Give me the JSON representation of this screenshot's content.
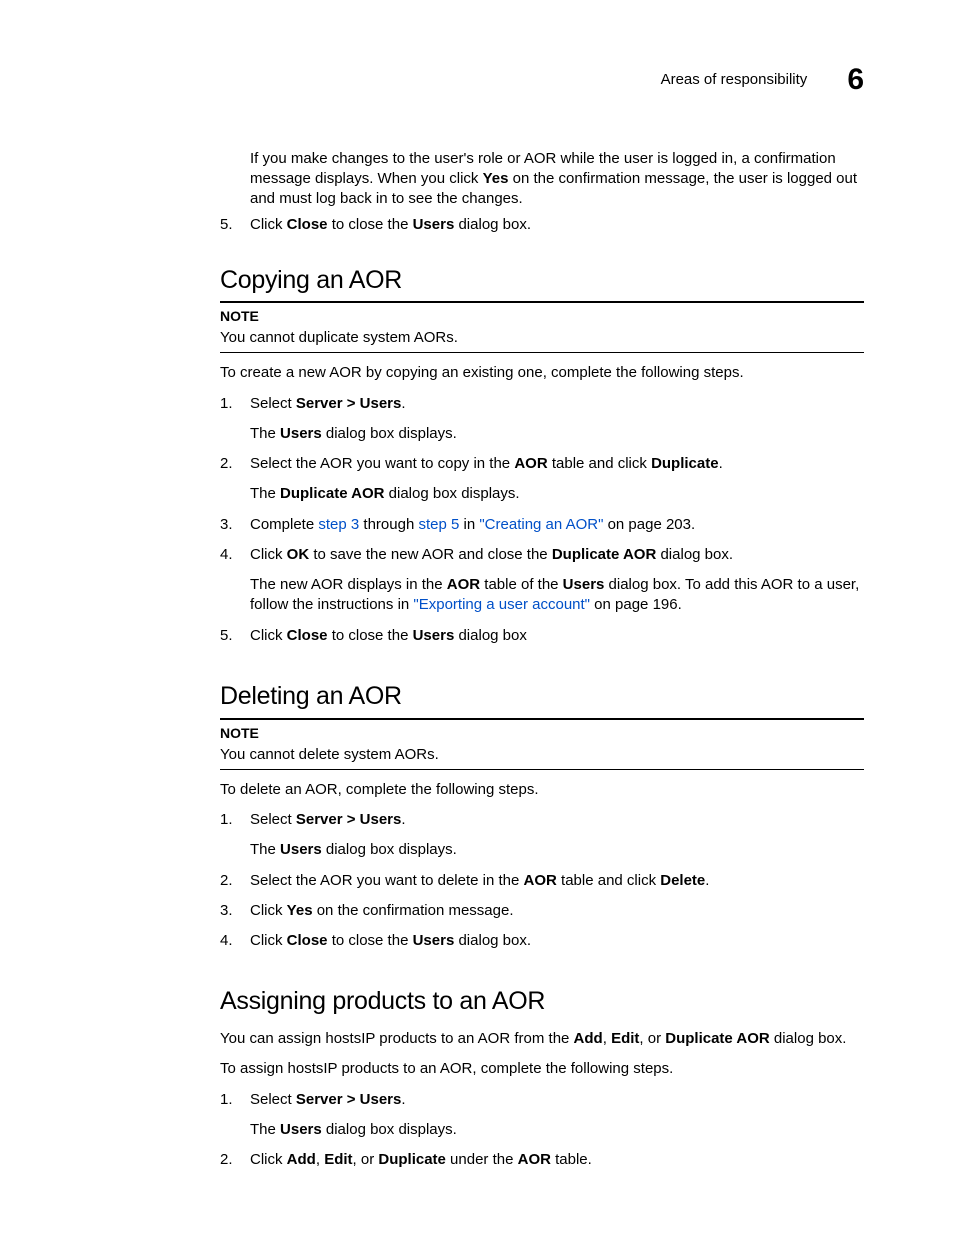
{
  "header": {
    "title": "Areas of responsibility",
    "chapter": "6"
  },
  "intro_block": {
    "para": "If you make changes to the user's role or AOR while the user is logged in, a confirmation message displays. When you click ",
    "yes": "Yes",
    "para2": " on the confirmation message, the user is logged out and must log back in to see the changes."
  },
  "step5top": {
    "num": "5.",
    "pre": "Click ",
    "close": "Close",
    "mid": " to close the ",
    "users": "Users",
    "post": " dialog box."
  },
  "copying": {
    "heading": "Copying an AOR",
    "note_label": "NOTE",
    "note_text": "You cannot duplicate system AORs.",
    "intro": "To create a new AOR by copying an existing one, complete the following steps.",
    "steps": {
      "s1": {
        "num": "1.",
        "pre": "Select ",
        "b": "Server > Users",
        "post": ".",
        "sub_pre": "The ",
        "sub_b": "Users",
        "sub_post": " dialog box displays."
      },
      "s2": {
        "num": "2.",
        "pre": "Select the AOR you want to copy in the ",
        "b1": "AOR",
        "mid": " table and click ",
        "b2": "Duplicate",
        "post": ".",
        "sub_pre": "The ",
        "sub_b": "Duplicate AOR",
        "sub_post": " dialog box displays."
      },
      "s3": {
        "num": "3.",
        "pre": "Complete ",
        "l1": "step 3",
        "mid1": " through ",
        "l2": "step 5",
        "mid2": " in ",
        "l3": "\"Creating an AOR\"",
        "post": " on page 203."
      },
      "s4": {
        "num": "4.",
        "pre": "Click ",
        "b1": "OK",
        "mid": " to save the new AOR and close the ",
        "b2": "Duplicate AOR",
        "post": " dialog box.",
        "sub_pre": "The new AOR displays in the ",
        "sub_b1": "AOR",
        "sub_mid1": " table of the ",
        "sub_b2": "Users",
        "sub_mid2": " dialog box. To add this AOR to a user, follow the instructions in ",
        "sub_link": "\"Exporting a user account\"",
        "sub_post": " on page 196."
      },
      "s5": {
        "num": "5.",
        "pre": "Click ",
        "b1": "Close",
        "mid": " to close the ",
        "b2": "Users",
        "post": " dialog box"
      }
    }
  },
  "deleting": {
    "heading": "Deleting an AOR",
    "note_label": "NOTE",
    "note_text": "You cannot delete system AORs.",
    "intro": "To delete an AOR, complete the following steps.",
    "steps": {
      "s1": {
        "num": "1.",
        "pre": "Select ",
        "b": "Server > Users",
        "post": ".",
        "sub_pre": "The ",
        "sub_b": "Users",
        "sub_post": " dialog box displays."
      },
      "s2": {
        "num": "2.",
        "pre": "Select the AOR you want to delete in the ",
        "b1": "AOR",
        "mid": " table and click ",
        "b2": "Delete",
        "post": "."
      },
      "s3": {
        "num": "3.",
        "pre": "Click ",
        "b": "Yes",
        "post": " on the confirmation message."
      },
      "s4": {
        "num": "4.",
        "pre": "Click ",
        "b1": "Close",
        "mid": " to close the ",
        "b2": "Users",
        "post": " dialog box."
      }
    }
  },
  "assigning": {
    "heading": "Assigning products to an AOR",
    "intro1_pre": "You can assign hostsIP products to an AOR from the ",
    "intro1_b1": "Add",
    "intro1_c1": ", ",
    "intro1_b2": "Edit",
    "intro1_c2": ", or ",
    "intro1_b3": "Duplicate AOR",
    "intro1_post": " dialog box.",
    "intro2": "To assign hostsIP products to an AOR, complete the following steps.",
    "steps": {
      "s1": {
        "num": "1.",
        "pre": "Select ",
        "b": "Server > Users",
        "post": ".",
        "sub_pre": "The ",
        "sub_b": "Users",
        "sub_post": " dialog box displays."
      },
      "s2": {
        "num": "2.",
        "pre": "Click ",
        "b1": "Add",
        "c1": ", ",
        "b2": "Edit",
        "c2": ", or ",
        "b3": "Duplicate",
        "mid": " under the ",
        "b4": "AOR",
        "post": " table."
      }
    }
  }
}
